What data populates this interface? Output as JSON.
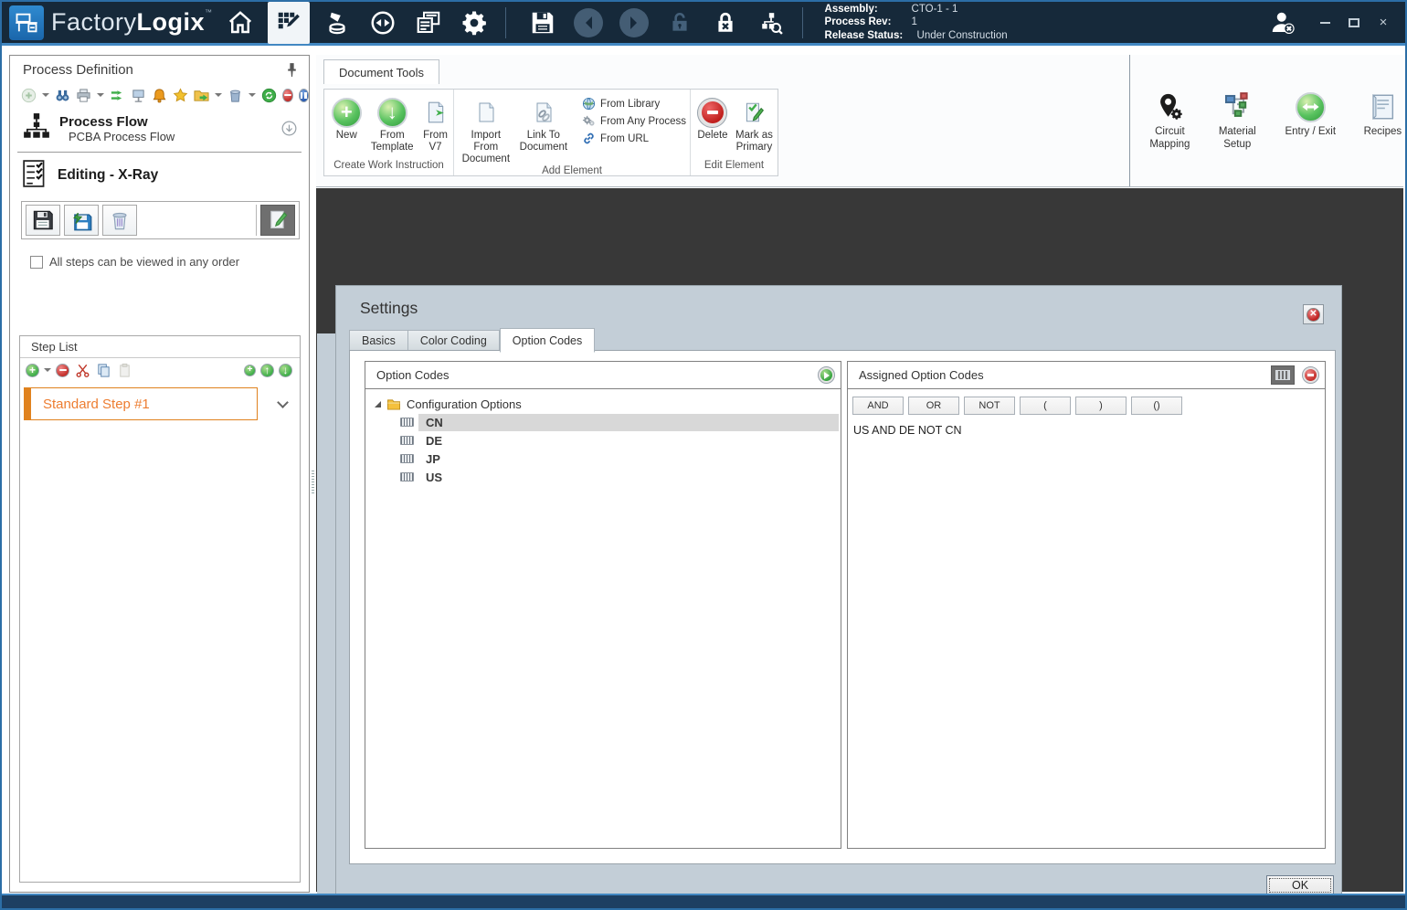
{
  "titlebar": {
    "brand": {
      "light": "Factory",
      "bold": "Logix",
      "tm": "™"
    },
    "status": [
      {
        "label": "Assembly:",
        "value": "CTO-1 - 1"
      },
      {
        "label": "Process Rev:",
        "value": "1"
      },
      {
        "label": "Release Status:",
        "value": "Under Construction"
      }
    ],
    "window_controls": {
      "minimize": "–",
      "close": "×"
    }
  },
  "left_panel": {
    "title": "Process Definition",
    "process_flow_title": "Process Flow",
    "process_flow_subtitle": "PCBA Process Flow",
    "editing_label": "Editing - X-Ray",
    "any_order_label": "All steps can be viewed in any order",
    "any_order_checked": false,
    "step_list_title": "Step List",
    "steps": [
      {
        "label": "Standard Step #1"
      }
    ]
  },
  "ribbon": {
    "tab_label": "Document Tools",
    "create_group": {
      "label": "Create Work Instruction",
      "new": "New",
      "from_template": "From Template",
      "from_v7": "From V7"
    },
    "add_group": {
      "label": "Add Element",
      "import": "Import From Document",
      "link": "Link To Document",
      "from_library": "From Library",
      "from_any_process": "From Any Process",
      "from_url": "From URL"
    },
    "edit_group": {
      "label": "Edit Element",
      "delete": "Delete",
      "mark_primary": "Mark as Primary"
    },
    "tools": [
      {
        "label": "Circuit Mapping"
      },
      {
        "label": "Material Setup"
      },
      {
        "label": "Entry / Exit"
      },
      {
        "label": "Recipes"
      }
    ]
  },
  "settings_dialog": {
    "title": "Settings",
    "tabs": [
      {
        "label": "Basics"
      },
      {
        "label": "Color Coding"
      },
      {
        "label": "Option Codes"
      }
    ],
    "active_tab": "Option Codes",
    "option_codes_header": "Option Codes",
    "tree_root": "Configuration Options",
    "tree_items": [
      {
        "label": "CN",
        "selected": true
      },
      {
        "label": "DE",
        "selected": false
      },
      {
        "label": "JP",
        "selected": false
      },
      {
        "label": "US",
        "selected": false
      }
    ],
    "assigned_header": "Assigned Option Codes",
    "operators": [
      {
        "label": "AND"
      },
      {
        "label": "OR"
      },
      {
        "label": "NOT"
      },
      {
        "label": "("
      },
      {
        "label": ")"
      },
      {
        "label": "()"
      }
    ],
    "expression": "US AND DE NOT CN",
    "ok_label": "OK"
  },
  "icons": {
    "sphere_plus_glyph": "+",
    "sphere_down_glyph": "↓",
    "up_arrow_glyph": "↑",
    "down_arrow_glyph": "↓",
    "plus_glyph": "+"
  },
  "colors": {
    "titlebar": "#16293a",
    "accent_blue": "#4288c2",
    "accent_orange": "#e0821e",
    "orange_text": "#ed7d31",
    "workspace": "#383838",
    "dialog": "#c3ced7",
    "green": "#3fae49",
    "red": "#c0201e",
    "selection_gray": "#d8d8d8"
  }
}
